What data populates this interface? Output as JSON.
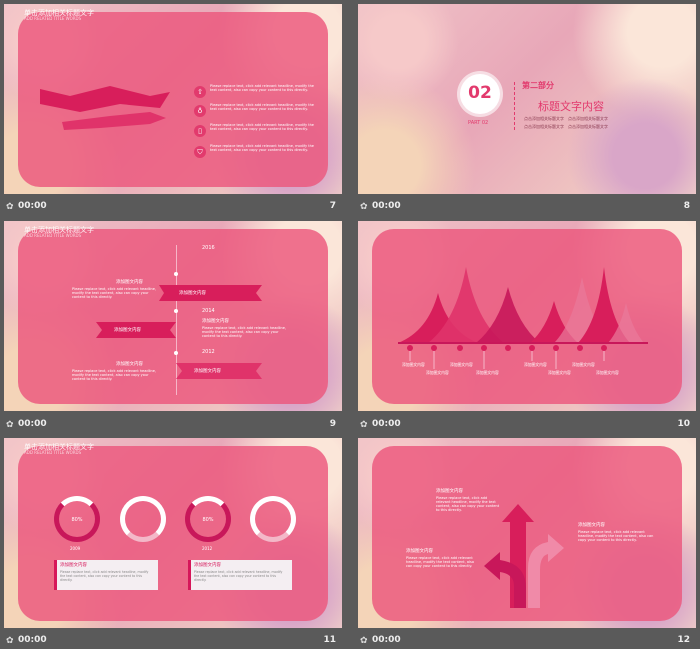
{
  "footer_time": "00:00",
  "slides": {
    "s7": {
      "number": "7",
      "title": "单击添加相关标题文字",
      "subtitle": "ADD RELATED TITLE WORDS",
      "items": [
        {
          "icon": "arrow-up-icon",
          "text": "Please replace text, click add relevant headline, modify the text content, also can copy your content to this directly."
        },
        {
          "icon": "bulb-icon",
          "text": "Please replace text, click add relevant headline, modify the text content, also can copy your content to this directly."
        },
        {
          "icon": "document-icon",
          "text": "Please replace text, click add relevant headline, modify the text content, also can copy your content to this directly."
        },
        {
          "icon": "shield-icon",
          "text": "Please replace text, click add relevant headline, modify the text content, also can copy your content to this directly."
        }
      ]
    },
    "s8": {
      "number": "8",
      "badge": "02",
      "part": "PART 02",
      "section": "第二部分",
      "heading": "标题文字内容",
      "bullets": [
        "点击添加相关标题文字",
        "点击添加相关标题文字",
        "点击添加相关标题文字",
        "点击添加相关标题文字"
      ]
    },
    "s9": {
      "number": "9",
      "title": "单击添加相关标题文字",
      "subtitle": "ADD RELATED TITLE WORDS",
      "years": [
        "2016",
        "2014",
        "2012"
      ],
      "banner": "添加图文内容",
      "label": "添加图文内容",
      "desc": "Please replace text, click add relevant headline, modify the text content, also can copy your content to this directly."
    },
    "s10": {
      "number": "10",
      "labels": [
        "添加图文内容",
        "添加图文内容",
        "添加图文内容",
        "添加图文内容",
        "添加图文内容",
        "添加图文内容",
        "添加图文内容",
        "添加图文内容"
      ]
    },
    "s11": {
      "number": "11",
      "title": "单击添加相关标题文字",
      "subtitle": "ADD RELATED TITLE WORDS",
      "rings": [
        {
          "value": "80%",
          "year": "2009"
        },
        {
          "value": "",
          "year": ""
        },
        {
          "value": "80%",
          "year": "2012"
        },
        {
          "value": "",
          "year": ""
        }
      ],
      "cards": [
        {
          "title": "添加图文内容",
          "text": "Please replace text, click add relevant headline, modify the text content, also can copy your content to this directly."
        },
        {
          "title": "添加图文内容",
          "text": "Please replace text, click add relevant headline, modify the text content, also can copy your content to this directly."
        }
      ]
    },
    "s12": {
      "number": "12",
      "label": "添加图文内容",
      "desc": "Please replace text, click add relevant headline, modify the text content, also can copy your content to this directly."
    }
  }
}
